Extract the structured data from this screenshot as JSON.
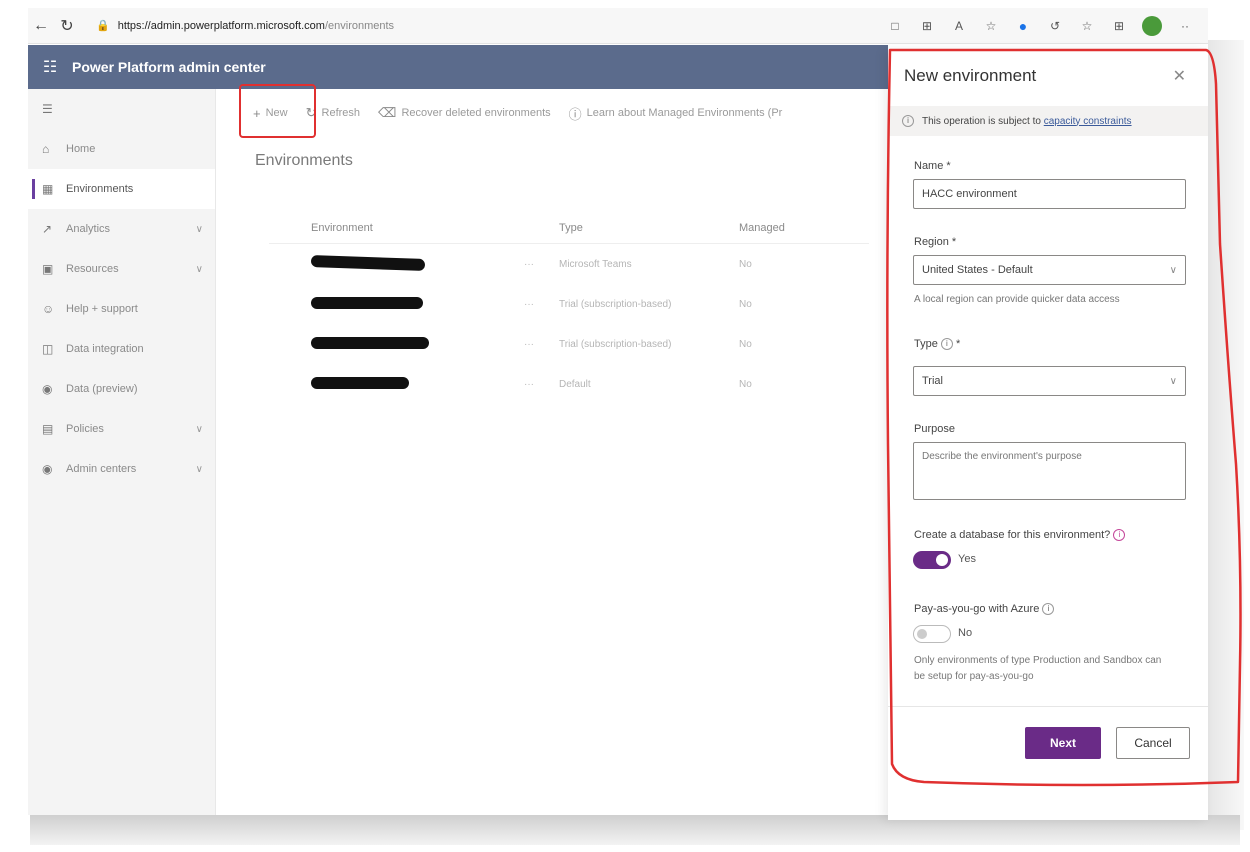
{
  "browser": {
    "url_host": "https://admin.powerplatform.microsoft.com",
    "url_path": "/environments"
  },
  "app": {
    "title": "Power Platform admin center"
  },
  "sidebar": {
    "items": [
      {
        "label": "Home",
        "icon": "home-icon"
      },
      {
        "label": "Environments",
        "icon": "environments-icon",
        "active": true
      },
      {
        "label": "Analytics",
        "icon": "analytics-icon",
        "expandable": true
      },
      {
        "label": "Resources",
        "icon": "resources-icon",
        "expandable": true
      },
      {
        "label": "Help + support",
        "icon": "help-icon"
      },
      {
        "label": "Data integration",
        "icon": "data-integration-icon"
      },
      {
        "label": "Data (preview)",
        "icon": "data-icon"
      },
      {
        "label": "Policies",
        "icon": "policies-icon",
        "expandable": true
      },
      {
        "label": "Admin centers",
        "icon": "admin-centers-icon",
        "expandable": true
      }
    ]
  },
  "commandbar": {
    "new_label": "New",
    "refresh_label": "Refresh",
    "recover_label": "Recover deleted environments",
    "learn_label": "Learn about Managed Environments (Pr"
  },
  "page": {
    "title": "Environments"
  },
  "table": {
    "headers": [
      "Environment",
      "Type",
      "Managed"
    ],
    "rows": [
      {
        "type": "Microsoft Teams",
        "managed": "No"
      },
      {
        "type": "Trial (subscription-based)",
        "managed": "No"
      },
      {
        "type": "Trial (subscription-based)",
        "managed": "No"
      },
      {
        "type": "Default",
        "managed": "No"
      }
    ],
    "more": "···"
  },
  "panel": {
    "title": "New environment",
    "notice_text": "This operation is subject to",
    "notice_link": "capacity constraints",
    "name_label": "Name *",
    "name_value": "HACC environment",
    "region_label": "Region *",
    "region_value": "United States - Default",
    "region_hint": "A local region can provide quicker data access",
    "type_label": "Type",
    "type_required": "*",
    "type_value": "Trial",
    "purpose_label": "Purpose",
    "purpose_placeholder": "Describe the environment's purpose",
    "db_label": "Create a database for this environment?",
    "db_value": "Yes",
    "payg_label": "Pay-as-you-go with Azure",
    "payg_value": "No",
    "payg_hint": "Only environments of type Production and Sandbox can be setup for pay-as-you-go",
    "next_label": "Next",
    "cancel_label": "Cancel"
  },
  "colors": {
    "accent": "#6a2b87",
    "topbar": "#5b6b8c",
    "annotation": "#e03030"
  }
}
